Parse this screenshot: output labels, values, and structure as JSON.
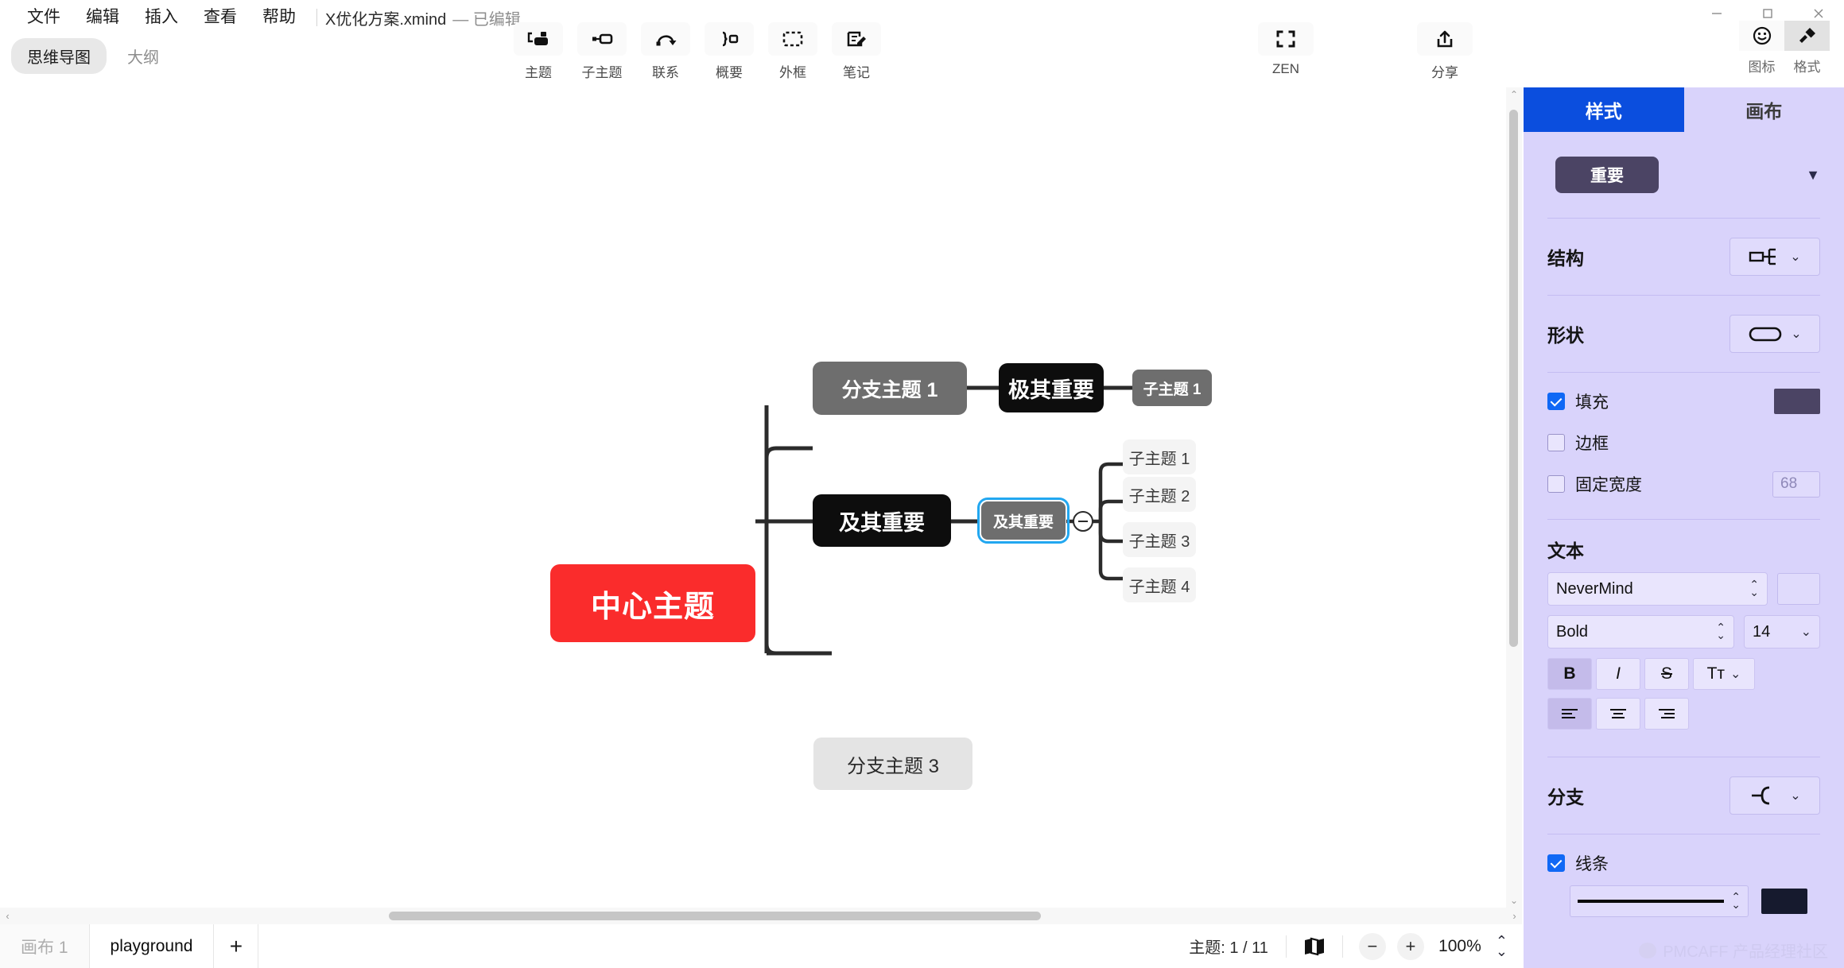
{
  "window": {
    "controls": [
      {
        "name": "minimize",
        "glyph": "minimize-icon"
      },
      {
        "name": "maximize",
        "glyph": "maximize-icon"
      },
      {
        "name": "close",
        "glyph": "close-icon"
      }
    ]
  },
  "menu": {
    "items": [
      "文件",
      "编辑",
      "插入",
      "查看",
      "帮助"
    ],
    "document_title": "X优化方案.xmind",
    "document_status": "— 已编辑"
  },
  "view_tabs": [
    {
      "label": "思维导图",
      "active": true
    },
    {
      "label": "大纲",
      "active": false
    }
  ],
  "toolbar": {
    "items": [
      {
        "label": "主题",
        "icon": "topic-icon"
      },
      {
        "label": "子主题",
        "icon": "subtopic-icon"
      },
      {
        "label": "联系",
        "icon": "relationship-icon"
      },
      {
        "label": "概要",
        "icon": "summary-icon"
      },
      {
        "label": "外框",
        "icon": "boundary-icon"
      },
      {
        "label": "笔记",
        "icon": "notes-icon"
      }
    ],
    "zen": {
      "label": "ZEN",
      "icon": "zen-fullscreen-icon"
    },
    "share": {
      "label": "分享",
      "icon": "share-upload-icon"
    }
  },
  "right_small_tabs": [
    {
      "label": "图标",
      "icon": "smiley-icon",
      "active": false
    },
    {
      "label": "格式",
      "icon": "paintbrush-icon",
      "active": true
    }
  ],
  "mindmap": {
    "nodes": [
      {
        "id": "central",
        "text": "中心主题",
        "style": "central"
      },
      {
        "id": "branch1",
        "text": "分支主题 1",
        "style": "gray"
      },
      {
        "id": "extremely",
        "text": "极其重要",
        "style": "dark"
      },
      {
        "id": "sub1top",
        "text": "子主题 1",
        "style": "gray-small"
      },
      {
        "id": "important",
        "text": "及其重要",
        "style": "dark"
      },
      {
        "id": "selected",
        "text": "及其重要",
        "style": "selected"
      },
      {
        "id": "child1",
        "text": "子主题 1",
        "style": "faint"
      },
      {
        "id": "child2",
        "text": "子主题 2",
        "style": "faint"
      },
      {
        "id": "child3",
        "text": "子主题 3",
        "style": "faint"
      },
      {
        "id": "child4",
        "text": "子主题 4",
        "style": "faint"
      },
      {
        "id": "branch3",
        "text": "分支主题 3",
        "style": "light"
      }
    ],
    "collapse_toggle": "collapse-minus-icon",
    "watermark": "PMCAFF 产品经理社区"
  },
  "panel": {
    "tabs": [
      {
        "label": "样式",
        "active": true
      },
      {
        "label": "画布",
        "active": false
      }
    ],
    "style_preview": {
      "label": "重要",
      "color": "#4b4464",
      "caret": "caret-down-icon"
    },
    "structure": {
      "title": "结构",
      "icon": "structure-right-logic-icon"
    },
    "shape": {
      "title": "形状",
      "icon": "shape-rounded-rect-icon"
    },
    "fill": {
      "label": "填充",
      "checked": true,
      "color": "#4b4464"
    },
    "border": {
      "label": "边框",
      "checked": false
    },
    "fixed_width": {
      "label": "固定宽度",
      "checked": false,
      "value": "68"
    },
    "text": {
      "title": "文本",
      "font_family": "NeverMind",
      "font_weight": "Bold",
      "font_size": "14",
      "color": "#e0dbfc",
      "buttons": [
        {
          "name": "bold",
          "label": "B",
          "active": true
        },
        {
          "name": "italic",
          "label": "I",
          "active": false
        },
        {
          "name": "strikethrough",
          "label": "S",
          "active": false
        },
        {
          "name": "text-case",
          "label": "Tᴛ",
          "active": false
        }
      ],
      "align": [
        {
          "name": "align-left",
          "active": true
        },
        {
          "name": "align-center",
          "active": false
        },
        {
          "name": "align-right",
          "active": false
        }
      ]
    },
    "branch": {
      "title": "分支",
      "icon": "branch-curve-icon",
      "line": {
        "label": "线条",
        "checked": true,
        "color": "#161a2e"
      }
    }
  },
  "bottom": {
    "sheets": [
      {
        "label": "画布 1",
        "active": false
      },
      {
        "label": "playground",
        "active": true
      }
    ],
    "add_sheet": "+",
    "topic_count": "主题: 1 / 11",
    "map_icon": "map-overview-icon",
    "zoom": {
      "minus": "−",
      "plus": "+",
      "value": "100%",
      "stepper": "zoom-stepper-icon"
    }
  }
}
